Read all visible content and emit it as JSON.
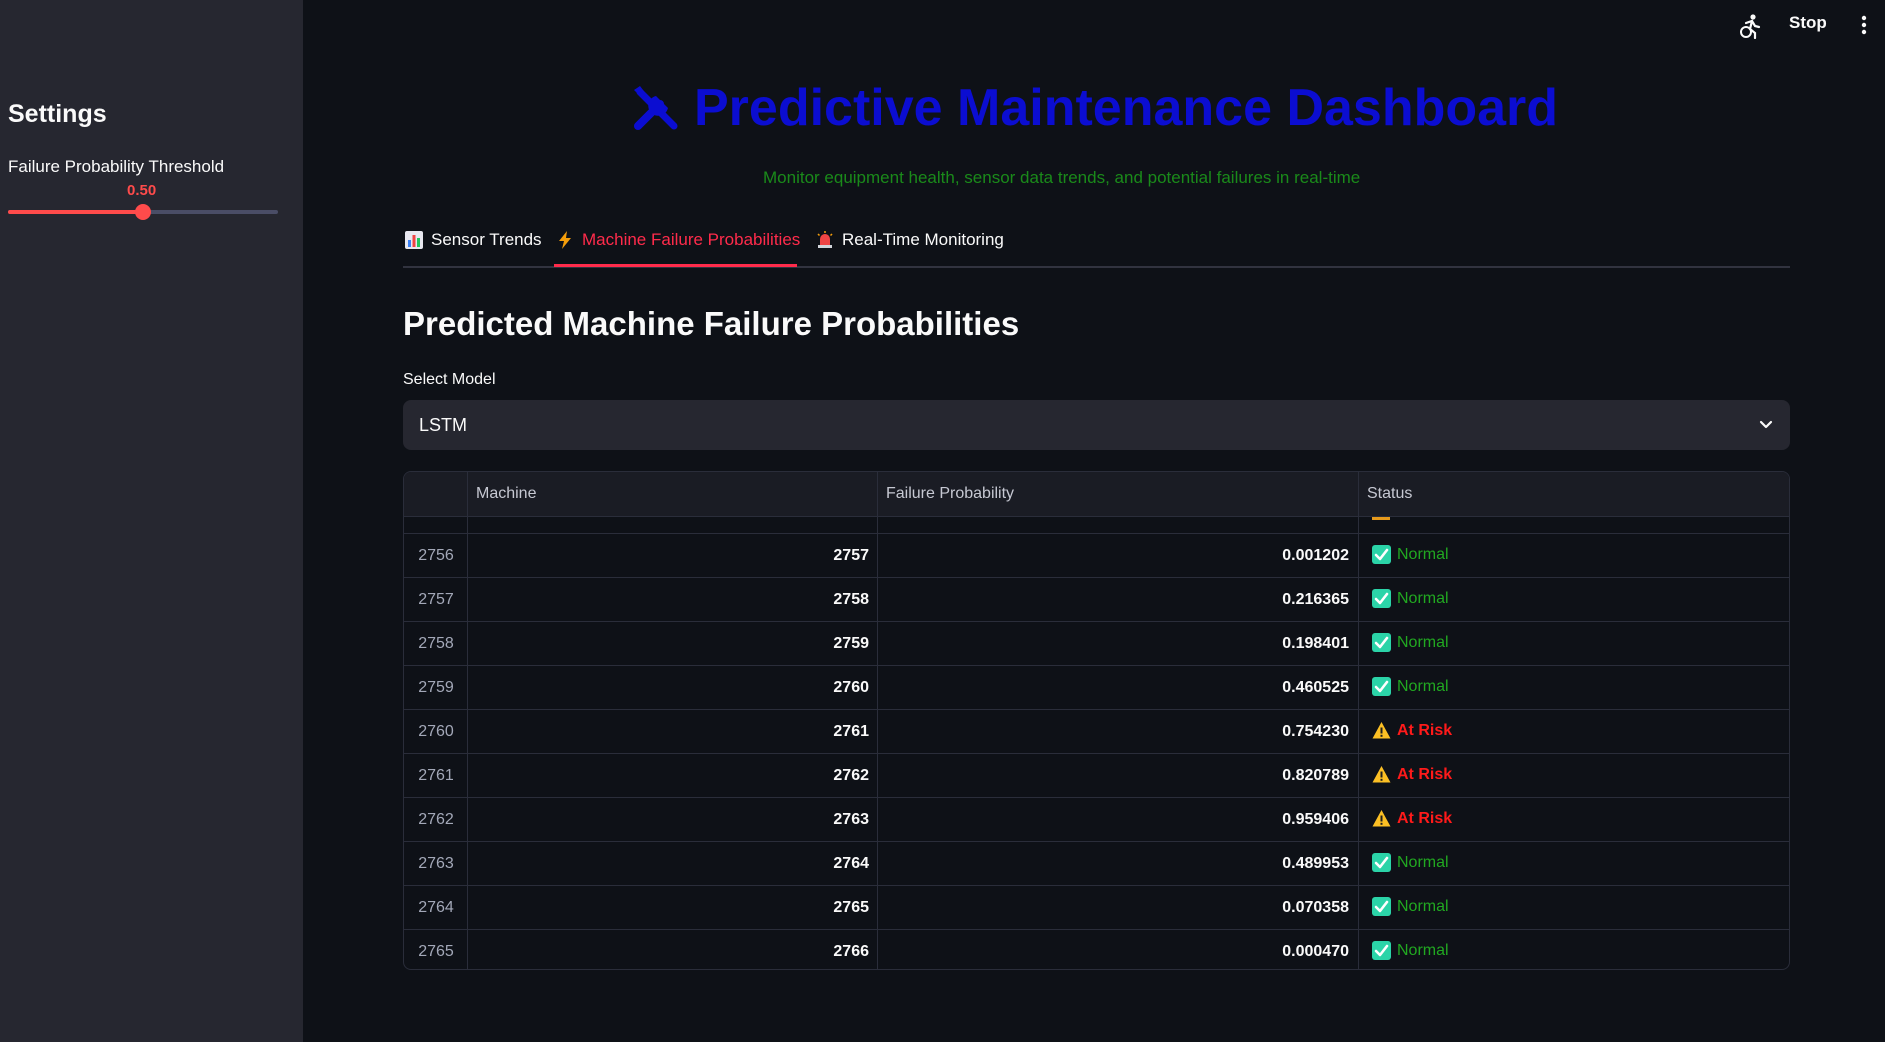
{
  "sidebar": {
    "title": "Settings",
    "slider_label": "Failure Probability Threshold",
    "slider_value": "0.50",
    "slider_fraction": 0.5
  },
  "toolbar": {
    "stop_label": "Stop"
  },
  "header": {
    "title": "Predictive Maintenance Dashboard",
    "subtitle": "Monitor equipment health, sensor data trends, and potential failures in real-time"
  },
  "tabs": [
    {
      "label": "Sensor Trends",
      "icon": "bar-chart-icon"
    },
    {
      "label": "Machine Failure Probabilities",
      "icon": "lightning-icon"
    },
    {
      "label": "Real-Time Monitoring",
      "icon": "siren-icon"
    }
  ],
  "section": {
    "title": "Predicted Machine Failure Probabilities",
    "select_label": "Select Model",
    "select_value": "LSTM"
  },
  "table": {
    "headers": [
      "Machine",
      "Failure Probability",
      "Status"
    ],
    "rows": [
      {
        "index": "2756",
        "machine": "2757",
        "prob": "0.001202",
        "status": "Normal"
      },
      {
        "index": "2757",
        "machine": "2758",
        "prob": "0.216365",
        "status": "Normal"
      },
      {
        "index": "2758",
        "machine": "2759",
        "prob": "0.198401",
        "status": "Normal"
      },
      {
        "index": "2759",
        "machine": "2760",
        "prob": "0.460525",
        "status": "Normal"
      },
      {
        "index": "2760",
        "machine": "2761",
        "prob": "0.754230",
        "status": "At Risk"
      },
      {
        "index": "2761",
        "machine": "2762",
        "prob": "0.820789",
        "status": "At Risk"
      },
      {
        "index": "2762",
        "machine": "2763",
        "prob": "0.959406",
        "status": "At Risk"
      },
      {
        "index": "2763",
        "machine": "2764",
        "prob": "0.489953",
        "status": "Normal"
      },
      {
        "index": "2764",
        "machine": "2765",
        "prob": "0.070358",
        "status": "Normal"
      },
      {
        "index": "2765",
        "machine": "2766",
        "prob": "0.000470",
        "status": "Normal"
      }
    ]
  },
  "colors": {
    "accent": "#ff4b4b",
    "title": "#0b0dd1",
    "normal": "#21a821",
    "risk": "#ff1a1a"
  }
}
